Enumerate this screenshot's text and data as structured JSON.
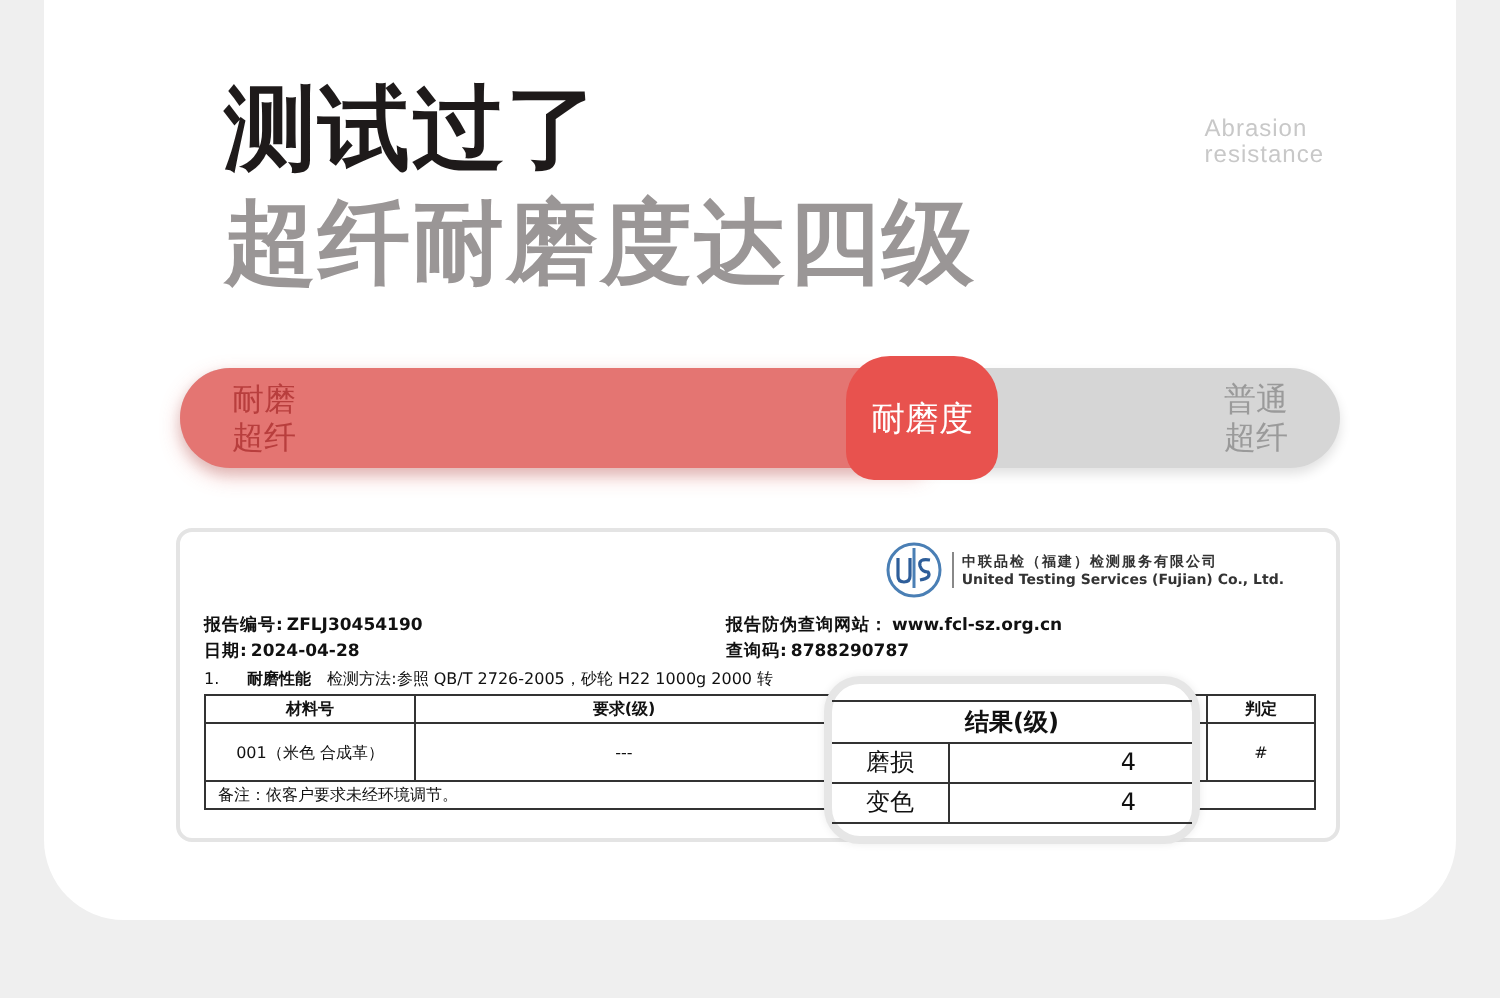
{
  "heading": {
    "title": "测试过了",
    "subtitle": "超纤耐磨度达四级",
    "tag": [
      "Abrasion",
      "resistance"
    ]
  },
  "slider": {
    "left_label": [
      "耐磨",
      "超纤"
    ],
    "right_label": [
      "普通",
      "超纤"
    ],
    "thumb_label": "耐磨度",
    "level": 0.64
  },
  "report": {
    "company_cn": "中联品检（福建）检测服务有限公司",
    "company_en": "United Testing Services (Fujian) Co., Ltd.",
    "fields": [
      {
        "label": "报告编号:",
        "value": "ZFLJ30454190"
      },
      {
        "label": "报告防伪查询网站：",
        "value": "www.fcl-sz.org.cn"
      },
      {
        "label": "日期:",
        "value": "2024-04-28"
      },
      {
        "label": "查询码:",
        "value": "8788290787"
      }
    ],
    "section": {
      "number": "1.",
      "name": "耐磨性能",
      "method": "检测方法:参照 QB/T 2726-2005，砂轮 H22 1000g 2000 转"
    },
    "columns": [
      "材料号",
      "要求(级)",
      "判定"
    ],
    "row": [
      "001（米色  合成革）",
      "---",
      "#"
    ],
    "note": "备注：依客户要求未经环境调节。",
    "magnifier": {
      "header": "结果(级)",
      "rows": [
        {
          "label": "磨损",
          "value": "4"
        },
        {
          "label": "变色",
          "value": "4"
        }
      ]
    }
  }
}
